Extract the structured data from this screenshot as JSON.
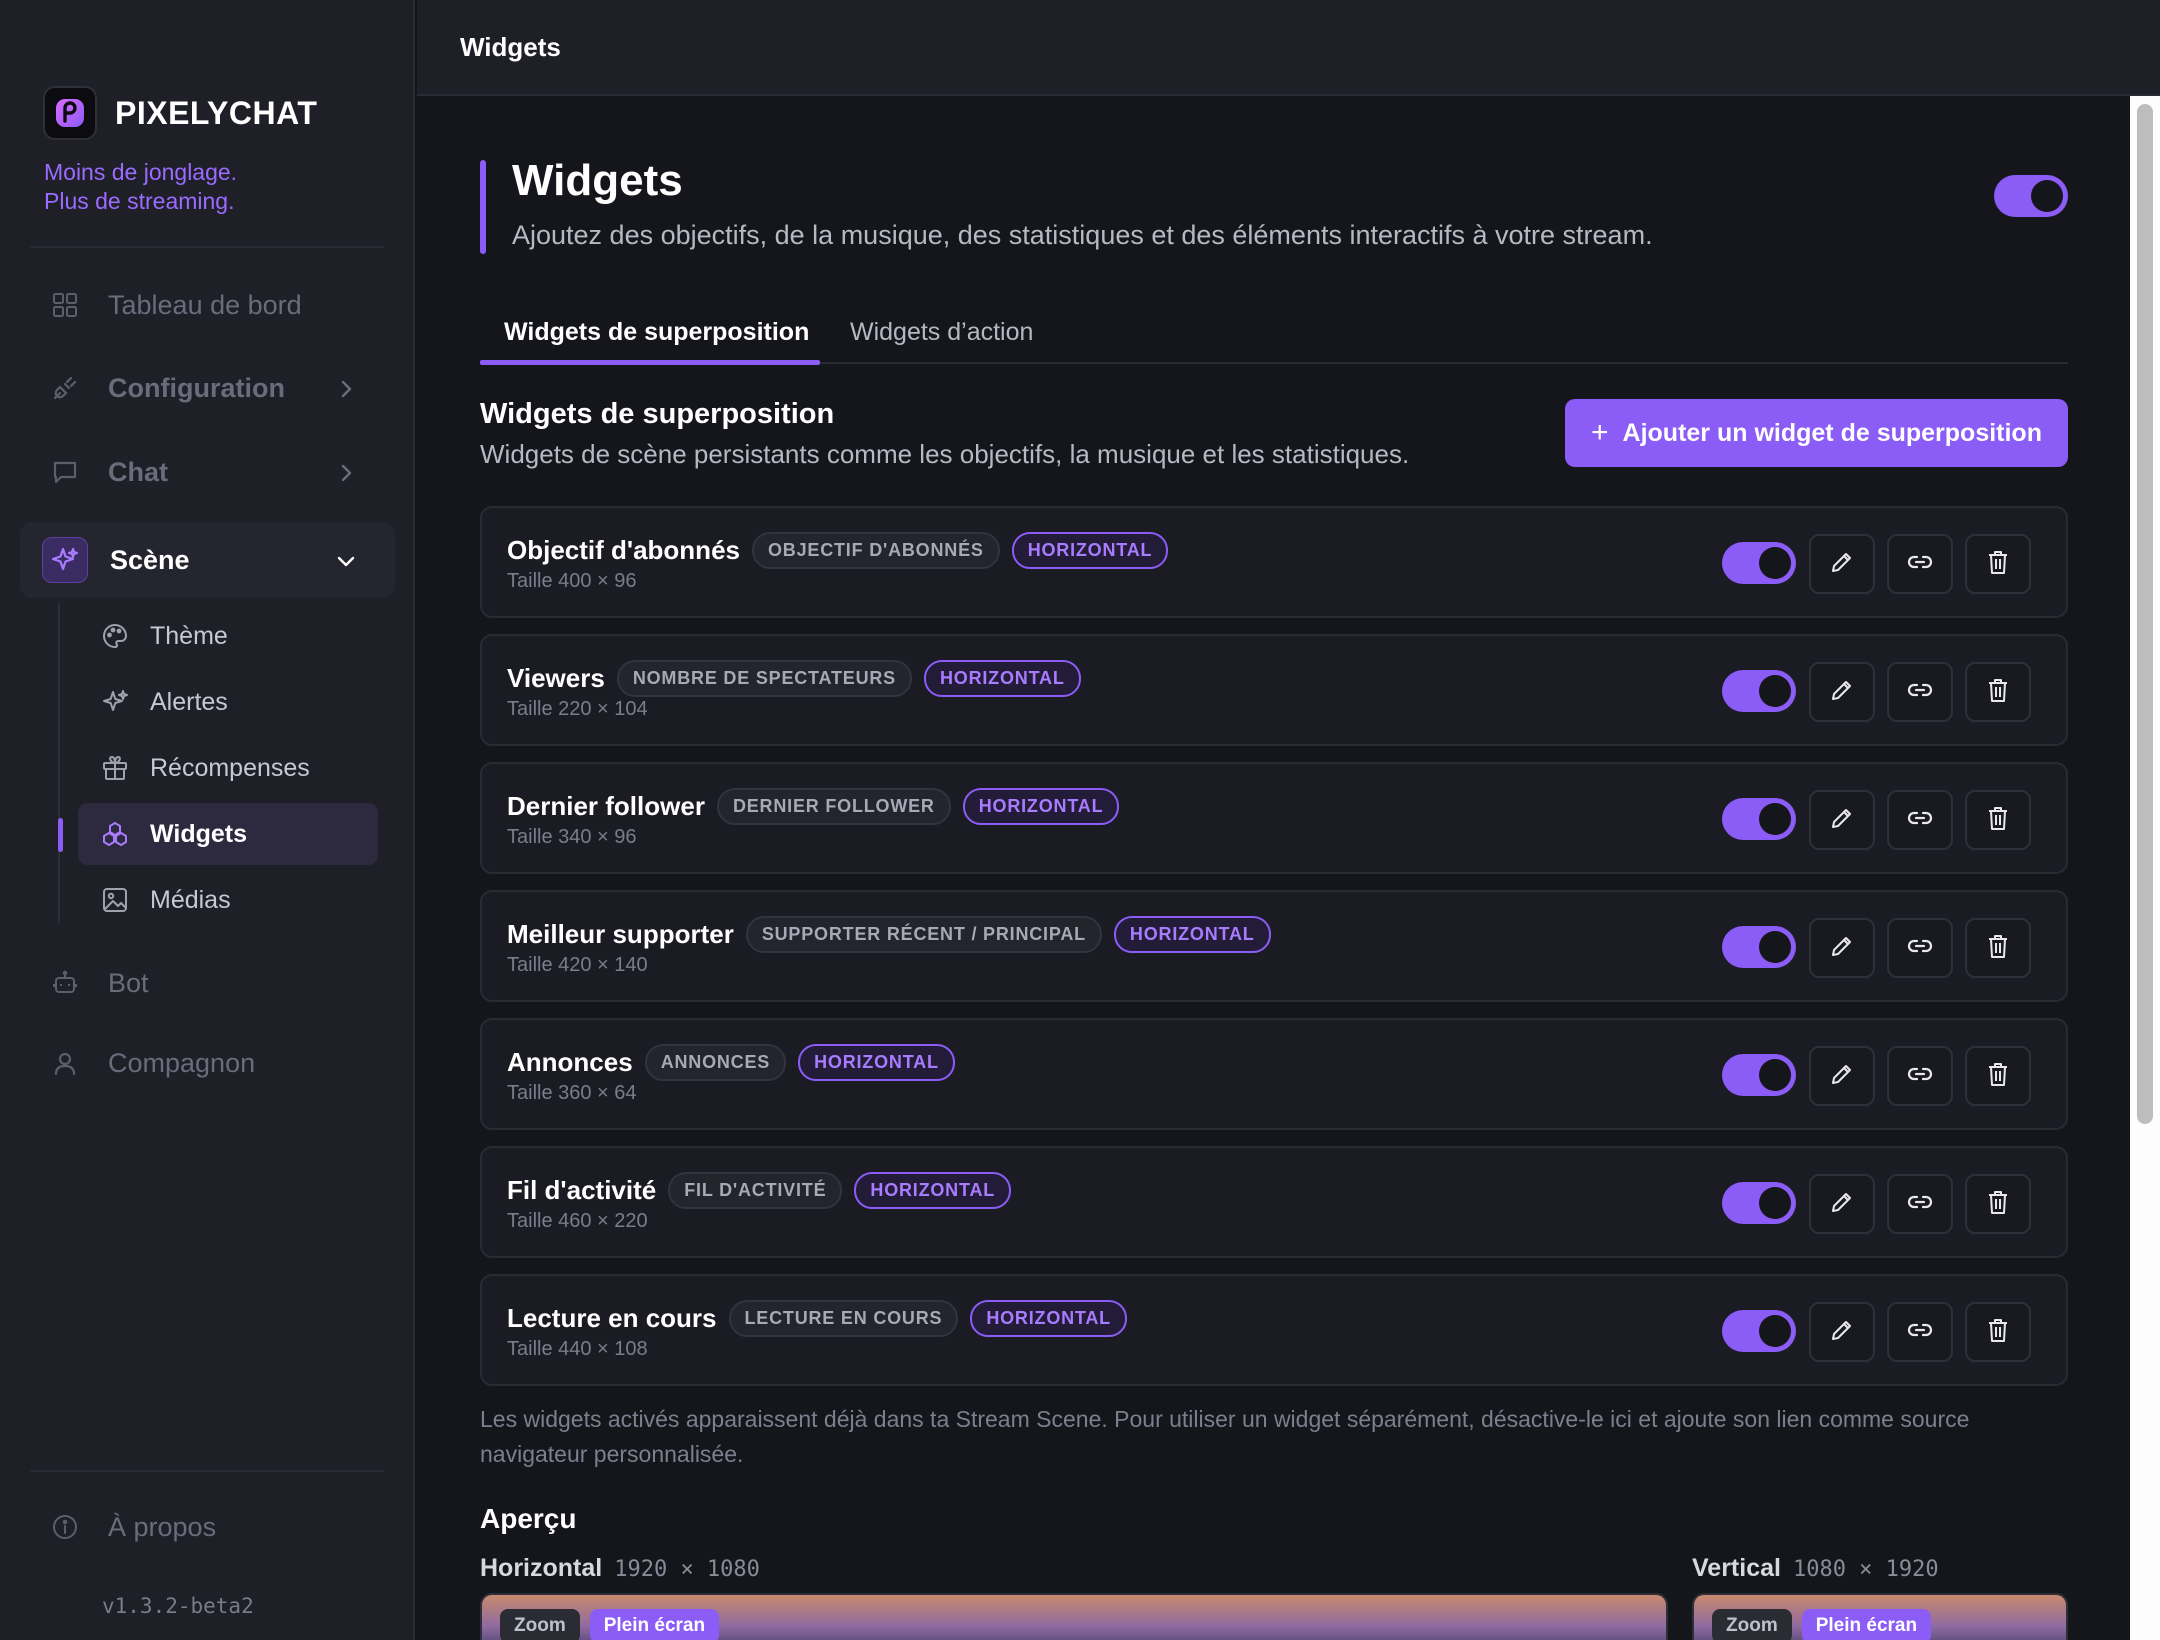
{
  "brand": {
    "name": "PIXELYCHAT",
    "tagline_1": "Moins de jonglage.",
    "tagline_2": "Plus de streaming."
  },
  "nav": {
    "dashboard": "Tableau de bord",
    "configuration": "Configuration",
    "chat": "Chat",
    "scene": "Scène",
    "scene_items": {
      "theme": "Thème",
      "alerts": "Alertes",
      "rewards": "Récompenses",
      "widgets": "Widgets",
      "media": "Médias"
    },
    "bot": "Bot",
    "companion": "Compagnon",
    "about": "À propos",
    "version": "v1.3.2-beta2"
  },
  "topbar": {
    "title": "Widgets"
  },
  "page": {
    "title": "Widgets",
    "subtitle": "Ajoutez des objectifs, de la musique, des statistiques et des éléments interactifs à votre stream.",
    "enabled": true
  },
  "tabs": {
    "overlay": "Widgets de superposition",
    "action": "Widgets d’action"
  },
  "section": {
    "title": "Widgets de superposition",
    "subtitle": "Widgets de scène persistants comme les objectifs, la musique et les statistiques.",
    "add_button": "Ajouter un widget de superposition"
  },
  "widgets": [
    {
      "name": "Objectif d'abonnés",
      "type": "OBJECTIF D'ABONNÉS",
      "orientation": "HORIZONTAL",
      "size": "Taille 400 × 96",
      "enabled": true
    },
    {
      "name": "Viewers",
      "type": "NOMBRE DE SPECTATEURS",
      "orientation": "HORIZONTAL",
      "size": "Taille 220 × 104",
      "enabled": true
    },
    {
      "name": "Dernier follower",
      "type": "DERNIER FOLLOWER",
      "orientation": "HORIZONTAL",
      "size": "Taille 340 × 96",
      "enabled": true
    },
    {
      "name": "Meilleur supporter",
      "type": "SUPPORTER RÉCENT / PRINCIPAL",
      "orientation": "HORIZONTAL",
      "size": "Taille 420 × 140",
      "enabled": true
    },
    {
      "name": "Annonces",
      "type": "ANNONCES",
      "orientation": "HORIZONTAL",
      "size": "Taille 360 × 64",
      "enabled": true
    },
    {
      "name": "Fil d'activité",
      "type": "FIL D'ACTIVITÉ",
      "orientation": "HORIZONTAL",
      "size": "Taille 460 × 220",
      "enabled": true
    },
    {
      "name": "Lecture en cours",
      "type": "LECTURE EN COURS",
      "orientation": "HORIZONTAL",
      "size": "Taille 440 × 108",
      "enabled": true
    }
  ],
  "note": "Les widgets activés apparaissent déjà dans ta Stream Scene. Pour utiliser un widget séparément, désactive-le ici et ajoute son lien comme source navigateur personnalisée.",
  "preview": {
    "title": "Aperçu",
    "horizontal_label": "Horizontal",
    "horizontal_dims": "1920 × 1080",
    "vertical_label": "Vertical",
    "vertical_dims": "1080 × 1920",
    "zoom": "Zoom",
    "fullscreen": "Plein écran"
  },
  "colors": {
    "accent": "#8b5cf6",
    "background": "#15151c",
    "sidebar": "#1f1f28",
    "card": "#1b1b23"
  }
}
